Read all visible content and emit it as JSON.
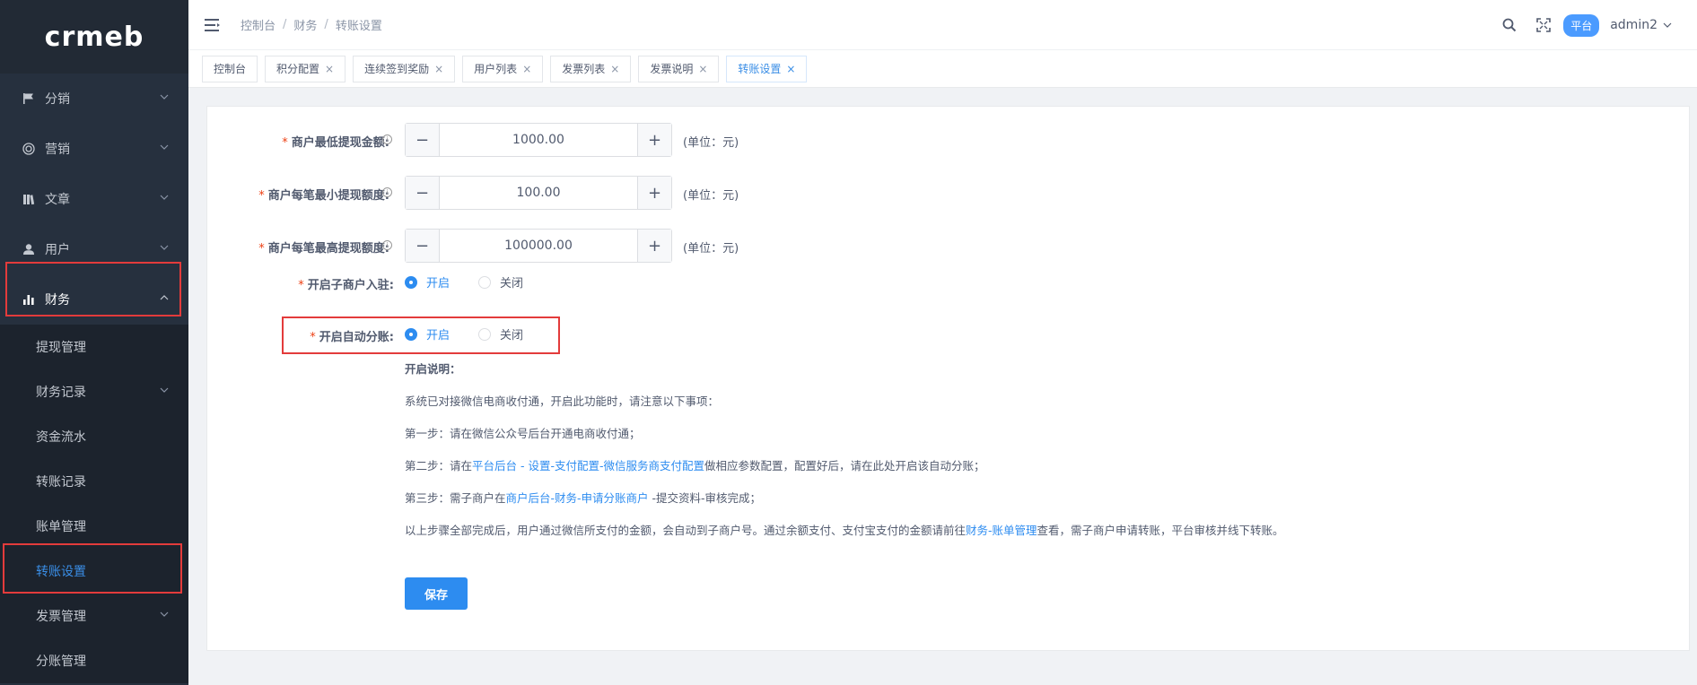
{
  "logo": "crmeb",
  "sidebar": {
    "items": [
      {
        "label": "分销",
        "icon": "flag-icon"
      },
      {
        "label": "营销",
        "icon": "target-icon"
      },
      {
        "label": "文章",
        "icon": "book-icon"
      },
      {
        "label": "用户",
        "icon": "user-icon"
      },
      {
        "label": "财务",
        "icon": "bar-chart-icon"
      }
    ],
    "finance_sub": [
      {
        "label": "提现管理"
      },
      {
        "label": "财务记录"
      },
      {
        "label": "资金流水"
      },
      {
        "label": "转账记录"
      },
      {
        "label": "账单管理"
      },
      {
        "label": "转账设置"
      },
      {
        "label": "发票管理"
      },
      {
        "label": "分账管理"
      }
    ]
  },
  "header": {
    "breadcrumb": [
      "控制台",
      "财务",
      "转账设置"
    ],
    "platform": "平台",
    "user": "admin2"
  },
  "tags": [
    {
      "label": "控制台",
      "closable": false
    },
    {
      "label": "积分配置",
      "closable": true
    },
    {
      "label": "连续签到奖励",
      "closable": true
    },
    {
      "label": "用户列表",
      "closable": true
    },
    {
      "label": "发票列表",
      "closable": true
    },
    {
      "label": "发票说明",
      "closable": true
    },
    {
      "label": "转账设置",
      "closable": true,
      "active": true
    }
  ],
  "form": {
    "min_withdraw": {
      "label": "商户最低提现金额:",
      "value": "1000.00",
      "unit": "(单位：元)"
    },
    "min_per": {
      "label": "商户每笔最小提现额度:",
      "value": "100.00",
      "unit": "(单位：元)"
    },
    "max_per": {
      "label": "商户每笔最高提现额度:",
      "value": "100000.00",
      "unit": "(单位：元)"
    },
    "sub_merchant": {
      "label": "开启子商户入驻:",
      "on": "开启",
      "off": "关闭",
      "selected": "开启"
    },
    "auto_split": {
      "label": "开启自动分账:",
      "on": "开启",
      "off": "关闭",
      "selected": "开启"
    }
  },
  "desc": {
    "title": "开启说明：",
    "line1": "系统已对接微信电商收付通，开启此功能时，请注意以下事项：",
    "line2": "第一步：请在微信公众号后台开通电商收付通；",
    "line3_pre": "第二步：请在",
    "line3_link": "平台后台 - 设置-支付配置-微信服务商支付配置",
    "line3_post": "做相应参数配置，配置好后，请在此处开启该自动分账；",
    "line4_pre": "第三步：需子商户在",
    "line4_link": "商户后台-财务-申请分账商户",
    "line4_post": " -提交资料-审核完成；",
    "line5_pre": "以上步骤全部完成后，用户通过微信所支付的金额，会自动到子商户号。通过余额支付、支付宝支付的金额请前往",
    "line5_link": "财务-账单管理",
    "line5_post": "查看，需子商户申请转账，平台审核并线下转账。"
  },
  "save_label": "保存"
}
